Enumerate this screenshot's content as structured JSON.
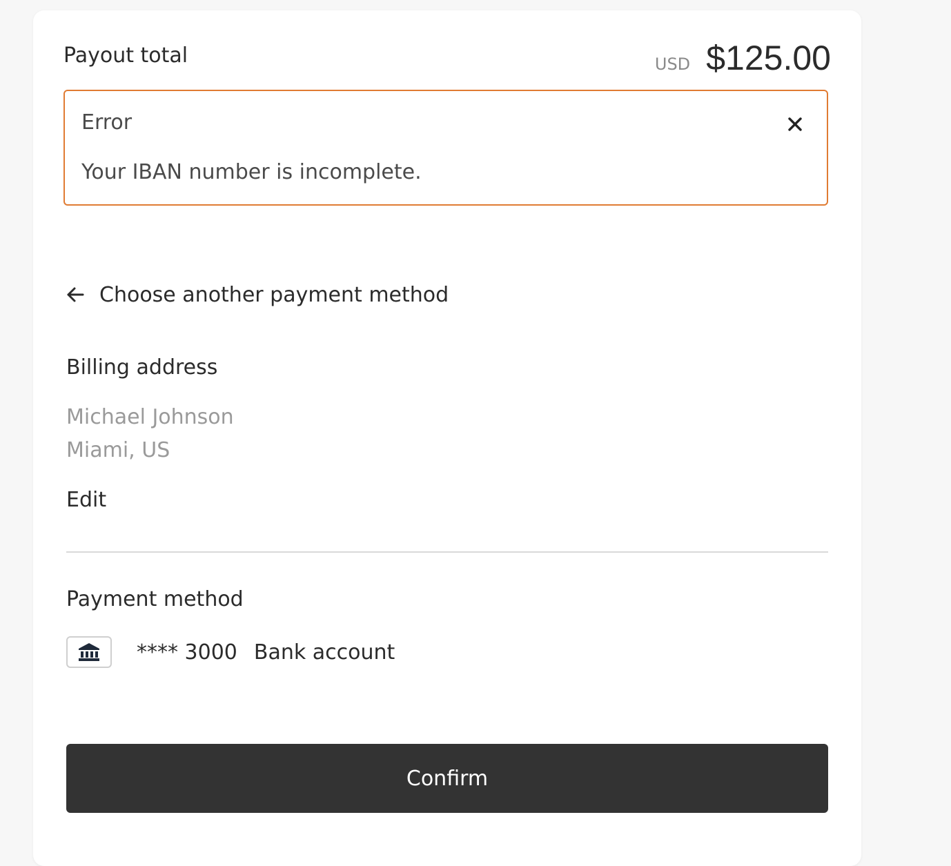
{
  "payout": {
    "label": "Payout total",
    "currency": "USD",
    "amount": "$125.00"
  },
  "error": {
    "title": "Error",
    "message": "Your IBAN number is incomplete.",
    "border_color": "#e07b32",
    "close_icon": "close-icon"
  },
  "back_link": {
    "label": "Choose another payment method",
    "icon": "arrow-left-icon"
  },
  "billing": {
    "title": "Billing address",
    "name": "Michael Johnson",
    "location": "Miami, US",
    "edit_label": "Edit"
  },
  "payment_method": {
    "title": "Payment method",
    "icon": "bank-icon",
    "masked_number": "**** 3000",
    "type": "Bank account"
  },
  "confirm": {
    "label": "Confirm",
    "background": "#333333"
  }
}
